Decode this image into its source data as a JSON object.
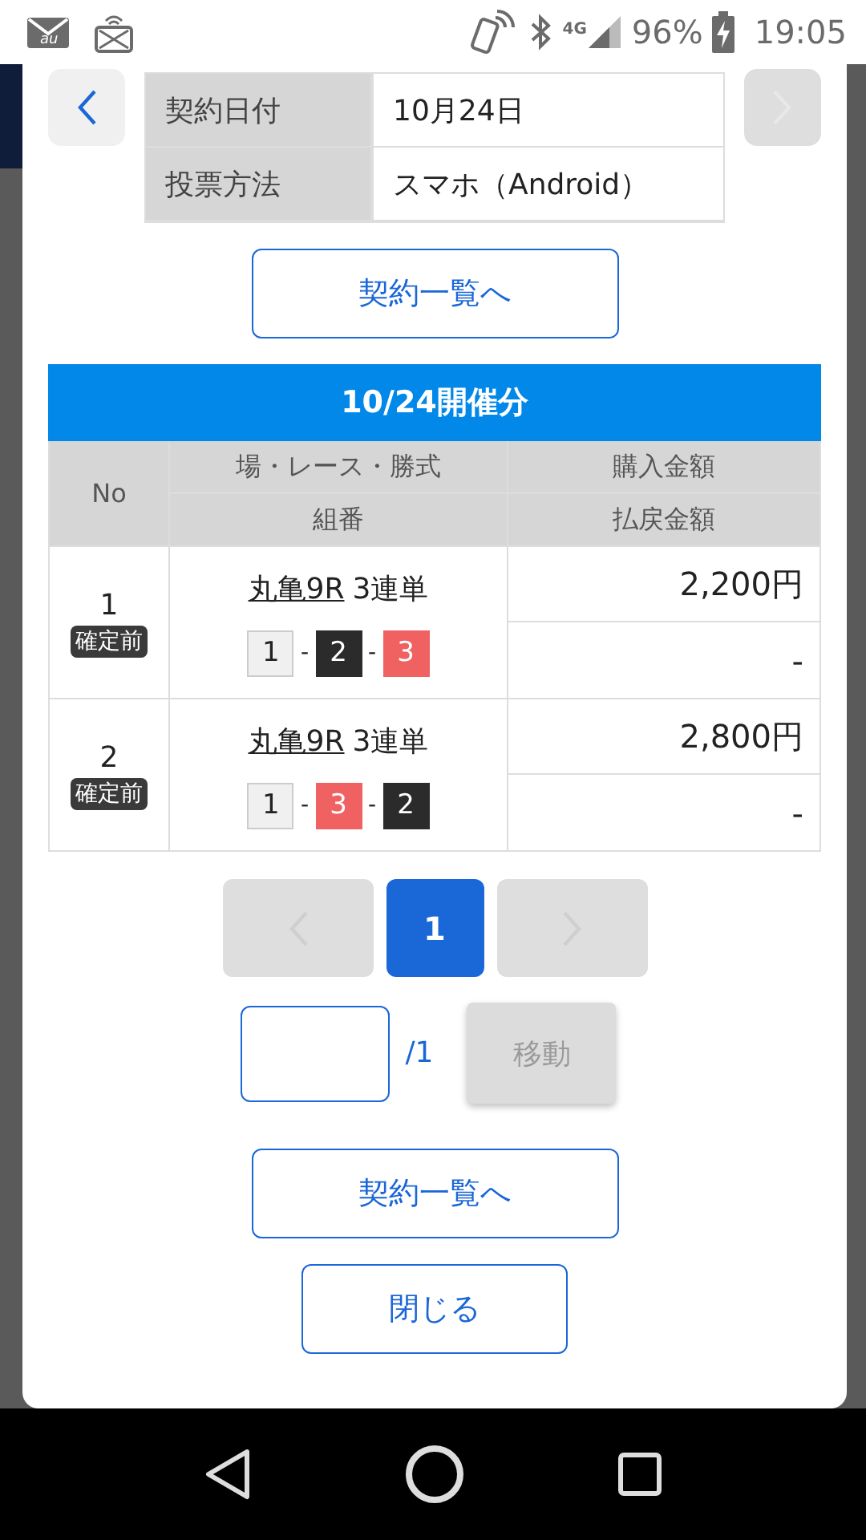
{
  "status_bar": {
    "mail_badge": "au",
    "network": "4G",
    "battery": "96%",
    "time": "19:05"
  },
  "top_nav": {
    "prev_disabled": false,
    "next_disabled": true
  },
  "info_rows": [
    {
      "label": "契約日付",
      "value": "10月24日"
    },
    {
      "label": "投票方法",
      "value": "スマホ（Android）"
    }
  ],
  "list_button_top": "契約一覧へ",
  "section_title": "10/24開催分",
  "table": {
    "columns": {
      "no": "No",
      "race": "場・レース・勝式",
      "combo": "組番",
      "purchase": "購入金額",
      "payout": "払戻金額"
    },
    "rows": [
      {
        "no": "1",
        "status": "確定前",
        "venue_race": "丸亀9R",
        "bet_type": "3連単",
        "combination": [
          {
            "number": "1",
            "color": "#f0f0f0"
          },
          {
            "number": "2",
            "color": "#2b2b2b"
          },
          {
            "number": "3",
            "color": "#f06262"
          }
        ],
        "separators": [
          "-",
          "-"
        ],
        "purchase": "2,200円",
        "payout": "-"
      },
      {
        "no": "2",
        "status": "確定前",
        "venue_race": "丸亀9R",
        "bet_type": "3連単",
        "combination": [
          {
            "number": "1",
            "color": "#f0f0f0"
          },
          {
            "number": "3",
            "color": "#f06262"
          },
          {
            "number": "2",
            "color": "#2b2b2b"
          }
        ],
        "separators": [
          "-",
          "-"
        ],
        "purchase": "2,800円",
        "payout": "-"
      }
    ]
  },
  "pagination": {
    "prev_disabled": true,
    "pages": [
      {
        "label": "1",
        "selected": true
      }
    ],
    "next_disabled": true,
    "total": "/1",
    "move_button": "移動",
    "move_disabled": true
  },
  "list_button_bottom": "契約一覧へ",
  "close_button": "閉じる"
}
